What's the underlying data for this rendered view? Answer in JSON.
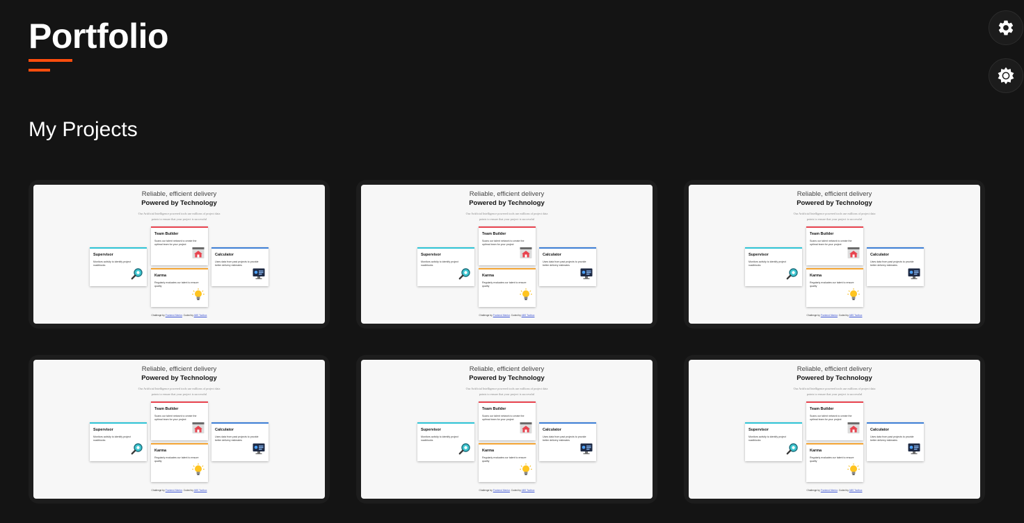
{
  "header": {
    "title": "Portfolio",
    "section_title": "My Projects"
  },
  "floating_buttons": [
    {
      "icon": "gear-icon"
    },
    {
      "icon": "sun-icon"
    }
  ],
  "colors": {
    "background": "#141414",
    "card": "#1d1d1d",
    "accent": "#ff4d0d"
  },
  "project_preview": {
    "heading_line1": "Reliable, efficient delivery",
    "heading_line2": "Powered by Technology",
    "description": "Our Artificial Intelligence powered tools use millions of project data points to ensure that your project is successful",
    "features": {
      "supervisor": {
        "name": "Supervisor",
        "text": "Monitors activity to identify project roadblocks"
      },
      "team_builder": {
        "name": "Team Builder",
        "text": "Scans our talent network to create the optimal team for your project"
      },
      "calculator": {
        "name": "Calculator",
        "text": "Uses data from past projects to provide better delivery estimates"
      },
      "karma": {
        "name": "Karma",
        "text": "Regularly evaluates our talent to ensure quality"
      }
    },
    "footer_prefix": "Challenge by",
    "footer_author": "Frontend Mentor",
    "footer_mid": ". Coded by",
    "footer_coder": "ABS Toolbox"
  },
  "projects_count_shown": 6
}
